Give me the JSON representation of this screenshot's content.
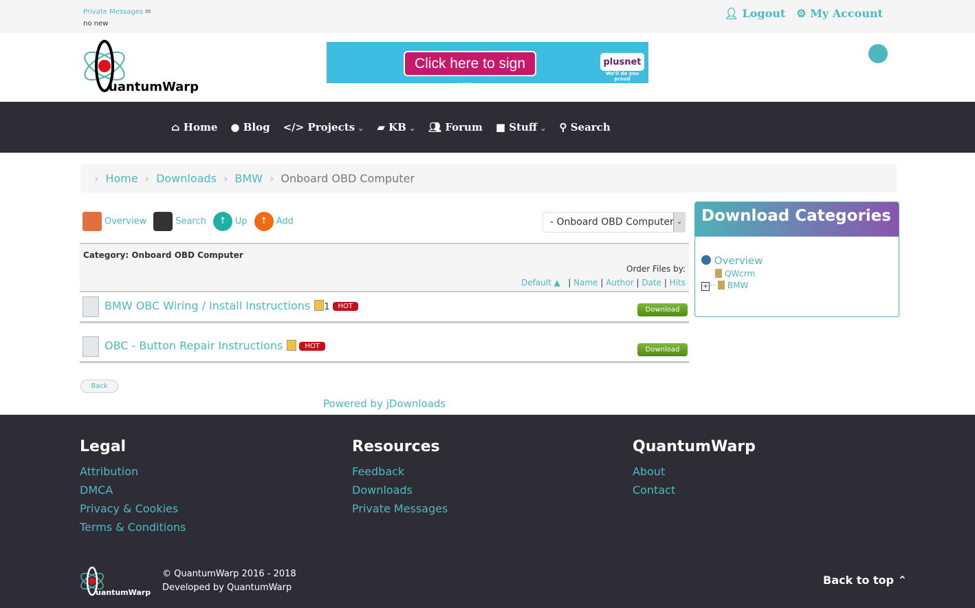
{
  "topbar": {
    "pm_label": "Private Messages",
    "pm_status": "no new",
    "logout": "Logout",
    "account": "My Account"
  },
  "logo": {
    "text": "QuantumWarp"
  },
  "banner": {
    "cta": "Click here to sign up ›",
    "brand": "plusnet",
    "tagline": "We'll do you proud"
  },
  "nav": [
    {
      "label": "Home",
      "icon": "home-icon"
    },
    {
      "label": "Blog",
      "icon": "comment-icon"
    },
    {
      "label": "Projects",
      "icon": "code-icon",
      "dropdown": true
    },
    {
      "label": "KB",
      "icon": "book-icon",
      "dropdown": true
    },
    {
      "label": "Forum",
      "icon": "users-icon"
    },
    {
      "label": "Stuff",
      "icon": "folder-icon",
      "dropdown": true
    },
    {
      "label": "Search",
      "icon": "search-icon"
    }
  ],
  "breadcrumb": [
    "Home",
    "Downloads",
    "BMW",
    "Onboard OBD Computer"
  ],
  "toolbar": {
    "overview": "Overview",
    "search": "Search",
    "up": "Up",
    "add": "Add",
    "category_select": "- Onboard OBD Computer"
  },
  "category": {
    "title": "Category: Onboard OBD Computer",
    "order_label": "Order Files by:",
    "sort": [
      "Default ▲",
      "Name",
      "Author",
      "Date",
      "Hits"
    ]
  },
  "files": [
    {
      "name": "BMW OBC Wiring / Install Instructions",
      "count": "1",
      "badge": "HOT",
      "button": "Download"
    },
    {
      "name": "OBC - Button Repair Instructions",
      "count": "",
      "badge": "HOT",
      "button": "Download"
    }
  ],
  "back": "Back",
  "powered": "Powered by jDownloads",
  "sidebar": {
    "title": "Download Categories",
    "overview": "Overview",
    "items": [
      "QWcrm",
      "BMW"
    ]
  },
  "footer": {
    "cols": [
      {
        "title": "Legal",
        "links": [
          "Attribution",
          "DMCA",
          "Privacy & Cookies",
          "Terms & Conditions"
        ]
      },
      {
        "title": "Resources",
        "links": [
          "Feedback",
          "Downloads",
          "Private Messages"
        ]
      },
      {
        "title": "QuantumWarp",
        "links": [
          "About",
          "Contact"
        ]
      }
    ],
    "copyright": "© QuantumWarp 2016 - 2018",
    "developed": "Developed by QuantumWarp",
    "back_to_top": "Back to top"
  },
  "colors": {
    "accent": "#4fb8bf",
    "nav_bg": "#2e2d36",
    "hot": "#c0141a",
    "download": "#5f9a20"
  }
}
